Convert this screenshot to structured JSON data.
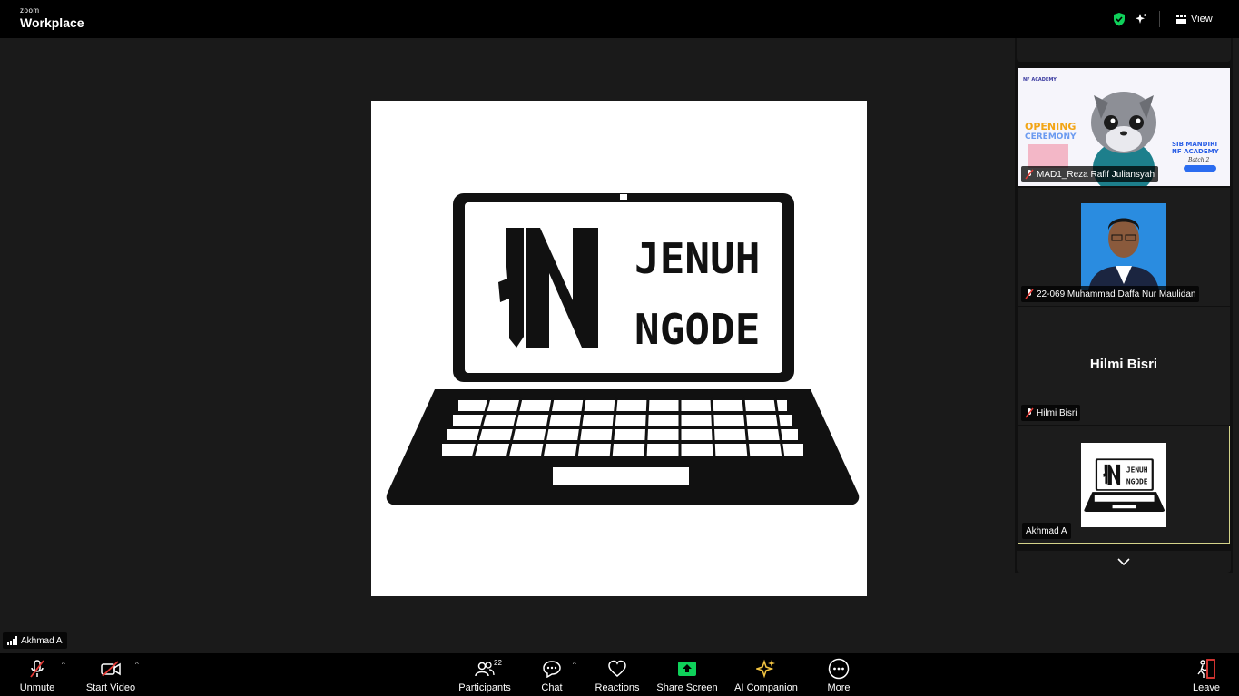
{
  "app": {
    "brand_small": "zoom",
    "brand_big": "Workplace"
  },
  "header": {
    "view_label": "View"
  },
  "participants_panel": {
    "tiles": [
      {
        "name": "MAD1_Reza Rafif Juliansyah",
        "muted": true,
        "image": {
          "text1": "OPENING",
          "text2": "CEREMONY",
          "text3": "SIB MANDIRI",
          "text4": "NF ACADEMY",
          "text5": "Batch 2",
          "top_text": "NF ACADEMY"
        }
      },
      {
        "name": "22-069 Muhammad Daffa Nur Maulidan",
        "muted": true
      },
      {
        "name": "Hilmi Bisri",
        "display_name": "Hilmi Bisri",
        "muted": true
      },
      {
        "name": "Akhmad A",
        "muted": false,
        "active": true
      }
    ]
  },
  "shared_content": {
    "line1": "JENUH",
    "line2": "NGODE"
  },
  "self_view": {
    "name": "Akhmad A"
  },
  "toolbar": {
    "unmute": "Unmute",
    "start_video": "Start Video",
    "participants": "Participants",
    "participants_count": "22",
    "chat": "Chat",
    "reactions": "Reactions",
    "share_screen": "Share Screen",
    "ai_companion": "AI Companion",
    "more": "More",
    "leave": "Leave"
  },
  "colors": {
    "accent_green": "#0fd15a",
    "muted_red": "#e53935",
    "active_border": "#d4d38a",
    "ai_yellow": "#f4c542"
  }
}
